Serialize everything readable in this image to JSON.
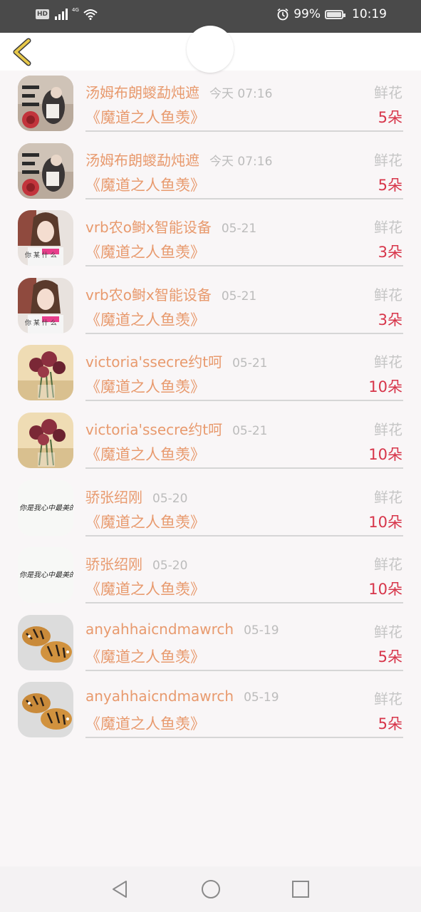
{
  "status_bar": {
    "hd": "HD",
    "network": "4G",
    "battery_text": "99%",
    "battery_level": 0.99,
    "time": "10:19"
  },
  "header": {
    "back_icon": "chevron-left-icon"
  },
  "rows": [
    {
      "avatar": "figure-wall",
      "name": "汤姆布朗蝬勐炖遮",
      "time": "今天 07:16",
      "gift_type": "鲜花",
      "book": "《魔道之人鱼羡》",
      "amount": "5朵"
    },
    {
      "avatar": "figure-wall",
      "name": "汤姆布朗蝬勐炖遮",
      "time": "今天 07:16",
      "gift_type": "鲜花",
      "book": "《魔道之人鱼羡》",
      "amount": "5朵"
    },
    {
      "avatar": "portrait",
      "name": "vrb农o鲥x智能设备",
      "time": "05-21",
      "gift_type": "鲜花",
      "book": "《魔道之人鱼羡》",
      "amount": "3朵"
    },
    {
      "avatar": "portrait",
      "name": "vrb农o鲥x智能设备",
      "time": "05-21",
      "gift_type": "鲜花",
      "book": "《魔道之人鱼羡》",
      "amount": "3朵"
    },
    {
      "avatar": "roses",
      "name": "victoria'ssecre约t呵",
      "time": "05-21",
      "gift_type": "鲜花",
      "book": "《魔道之人鱼羡》",
      "amount": "10朵"
    },
    {
      "avatar": "roses",
      "name": "victoria'ssecre约t呵",
      "time": "05-21",
      "gift_type": "鲜花",
      "book": "《魔道之人鱼羡》",
      "amount": "10朵"
    },
    {
      "avatar": "calligraphy",
      "name": "骄张绍刚",
      "time": "05-20",
      "gift_type": "鲜花",
      "book": "《魔道之人鱼羡》",
      "amount": "10朵"
    },
    {
      "avatar": "calligraphy",
      "name": "骄张绍刚",
      "time": "05-20",
      "gift_type": "鲜花",
      "book": "《魔道之人鱼羡》",
      "amount": "10朵"
    },
    {
      "avatar": "tigers",
      "name": "anyahhaicndmawrch",
      "time": "05-19",
      "gift_type": "鲜花",
      "book": "《魔道之人鱼羡》",
      "amount": "5朵"
    },
    {
      "avatar": "tigers",
      "name": "anyahhaicndmawrch",
      "time": "05-19",
      "gift_type": "鲜花",
      "book": "《魔道之人鱼羡》",
      "amount": "5朵"
    }
  ],
  "colors": {
    "accent": "#e89a6e",
    "amount": "#d7354a",
    "muted": "#bcbcbc",
    "back_icon": "#e7c84a"
  },
  "navbar": {
    "icons": [
      "back-triangle-icon",
      "home-circle-icon",
      "recents-square-icon"
    ]
  }
}
